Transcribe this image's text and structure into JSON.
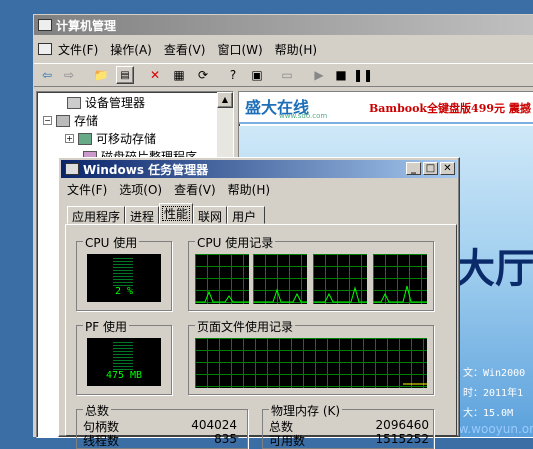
{
  "mmc": {
    "title": "计算机管理",
    "menu": [
      "文件(F)",
      "操作(A)",
      "查看(V)",
      "窗口(W)",
      "帮助(H)"
    ],
    "tree": [
      "设备管理器",
      "存储",
      "可移动存储",
      "磁盘碎片整理程序"
    ]
  },
  "web": {
    "logo": "盛大在线",
    "logo_url": "www.sdo.com",
    "ad": "Bambook全键盘版499元 震撼",
    "hall": "大厅",
    "info": [
      "文：Win2000",
      "时：2011年1",
      "大：15.0M"
    ],
    "footer": "www.wooyun.org"
  },
  "tm": {
    "title": "Windows 任务管理器",
    "menu": [
      "文件(F)",
      "选项(O)",
      "查看(V)",
      "帮助(H)"
    ],
    "tabs": [
      "应用程序",
      "进程",
      "性能",
      "联网",
      "用户"
    ],
    "cpu_usage_label": "CPU 使用",
    "cpu_history_label": "CPU 使用记录",
    "cpu_value": "2 %",
    "pf_label": "PF 使用",
    "pf_history_label": "页面文件使用记录",
    "pf_value": "475 MB",
    "totals_label": "总数",
    "handles_label": "句柄数",
    "handles_value": "404024",
    "threads_label": "线程数",
    "threads_value": "835",
    "phys_label": "物理内存 (K)",
    "phys_total_label": "总数",
    "phys_total_value": "2096460",
    "phys_avail_label": "可用数",
    "phys_avail_value": "1515252"
  }
}
